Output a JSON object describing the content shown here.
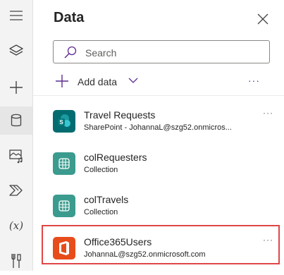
{
  "panel": {
    "title": "Data",
    "search": {
      "placeholder": "Search"
    },
    "add_data_label": "Add data",
    "more_glyph": "···"
  },
  "rail": {
    "icons": [
      "hamburger-icon",
      "layers-icon",
      "plus-icon",
      "database-icon",
      "media-icon",
      "power-automate-icon",
      "variables-icon",
      "tools-icon"
    ],
    "variables_label": "(x)"
  },
  "items": [
    {
      "name": "Travel Requests",
      "sub": "SharePoint - JohannaL@szg52.onmicros...",
      "icon": "sharepoint-icon",
      "more": "···"
    },
    {
      "name": "colRequesters",
      "sub": "Collection",
      "icon": "table-icon"
    },
    {
      "name": "colTravels",
      "sub": "Collection",
      "icon": "table-icon"
    },
    {
      "name": "Office365Users",
      "sub": "JohannaL@szg52.onmicrosoft.com",
      "icon": "office-icon",
      "more": "···"
    }
  ],
  "colors": {
    "accent": "#5c2d91",
    "sharepoint": "#036c70",
    "collection": "#3b9b8e",
    "office": "#e74c1b",
    "highlight": "#e04646"
  }
}
